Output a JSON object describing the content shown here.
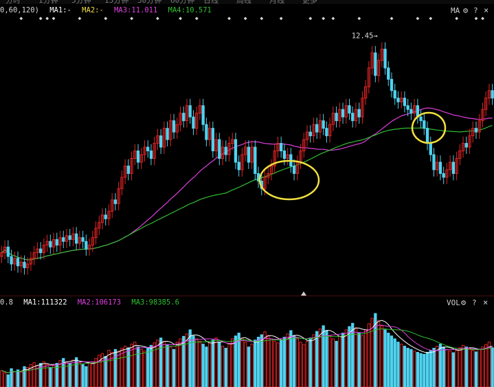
{
  "toolbar": {
    "tabs": [
      "分时",
      "1分钟",
      "5分钟",
      "15分钟",
      "30分钟",
      "60分钟",
      "日线",
      "周线",
      "月线",
      "更多"
    ]
  },
  "price_legend": {
    "period_text": "0,60,120)",
    "ma1": "MA1:-",
    "ma2": "MA2:-",
    "ma3": "MA3:11.011",
    "ma4": "MA4:10.571",
    "ma_button": "MA",
    "settings_icon": "gear-icon",
    "help_text": "?",
    "close_text": "×"
  },
  "volume_legend": {
    "prefix_text": "0.8",
    "ma1": "MA1:111322",
    "ma2": "MA2:106173",
    "ma3": "MA3:98385.6",
    "vol_button": "VOL",
    "settings_icon": "gear-icon",
    "help_text": "?",
    "close_text": "×"
  },
  "colors": {
    "up": "#e02424",
    "down": "#4fd3f0",
    "ma1": "#ffffff",
    "ma2": "#f0e040",
    "ma3": "#e040e0",
    "ma4": "#30c030",
    "annotation": "#f0e040",
    "marker": "#d8d8d8"
  },
  "chart_data": [
    {
      "type": "candlestick",
      "max_price_label": "12.45",
      "closes": [
        6.9,
        7.05,
        6.8,
        6.6,
        6.75,
        6.55,
        6.65,
        6.5,
        6.6,
        6.75,
        6.9,
        7.0,
        6.9,
        7.1,
        7.2,
        7.05,
        7.25,
        7.1,
        7.3,
        7.2,
        7.35,
        7.25,
        7.4,
        7.15,
        7.3,
        7.2,
        7.0,
        7.1,
        7.3,
        7.55,
        7.7,
        7.9,
        7.8,
        8.0,
        8.3,
        8.2,
        8.6,
        8.9,
        9.2,
        9.0,
        9.4,
        9.6,
        9.3,
        9.5,
        9.7,
        9.6,
        9.4,
        9.8,
        10.0,
        9.7,
        10.2,
        9.9,
        10.4,
        10.1,
        10.3,
        10.6,
        10.4,
        10.8,
        10.5,
        10.2,
        10.6,
        10.8,
        10.3,
        9.9,
        10.2,
        9.6,
        9.9,
        9.4,
        9.7,
        9.5,
        9.8,
        9.9,
        9.3,
        9.1,
        9.5,
        9.7,
        9.3,
        9.7,
        9.0,
        8.8,
        8.6,
        8.9,
        9.0,
        9.2,
        9.6,
        9.8,
        9.6,
        9.4,
        9.5,
        9.2,
        9.0,
        9.3,
        9.6,
        9.9,
        10.1,
        10.0,
        10.3,
        10.1,
        10.4,
        10.2,
        10.0,
        10.3,
        10.6,
        10.4,
        10.7,
        10.5,
        10.8,
        10.6,
        10.4,
        10.7,
        10.5,
        11.0,
        11.3,
        11.8,
        12.2,
        11.6,
        12.0,
        12.3,
        11.8,
        11.5,
        11.2,
        11.0,
        10.9,
        11.0,
        10.8,
        10.7,
        10.6,
        10.8,
        10.5,
        10.4,
        10.2,
        9.8,
        9.5,
        9.1,
        9.3,
        9.0,
        8.9,
        9.1,
        9.3,
        9.0,
        9.4,
        9.6,
        9.8,
        9.7,
        10.0,
        10.2,
        10.1,
        10.4,
        10.7,
        11.0,
        11.2,
        11.0
      ],
      "opens": [
        6.8,
        6.9,
        7.05,
        6.8,
        6.6,
        6.75,
        6.55,
        6.65,
        6.5,
        6.6,
        6.75,
        6.9,
        7.0,
        6.9,
        7.1,
        7.2,
        7.05,
        7.25,
        7.1,
        7.3,
        7.2,
        7.35,
        7.25,
        7.4,
        7.15,
        7.3,
        7.2,
        7.0,
        7.1,
        7.3,
        7.55,
        7.7,
        7.9,
        7.8,
        8.0,
        8.3,
        8.2,
        8.6,
        8.9,
        9.2,
        9.0,
        9.4,
        9.6,
        9.3,
        9.5,
        9.7,
        9.6,
        9.4,
        9.8,
        10.0,
        9.7,
        10.2,
        9.9,
        10.4,
        10.1,
        10.3,
        10.6,
        10.4,
        10.8,
        10.5,
        10.2,
        10.6,
        10.8,
        10.3,
        9.9,
        10.2,
        9.6,
        9.9,
        9.4,
        9.7,
        9.5,
        9.8,
        9.9,
        9.3,
        9.1,
        9.5,
        9.7,
        9.3,
        9.7,
        9.0,
        8.8,
        8.6,
        8.9,
        9.0,
        9.2,
        9.6,
        9.8,
        9.6,
        9.4,
        9.5,
        9.2,
        9.0,
        9.3,
        9.6,
        9.9,
        10.1,
        10.0,
        10.3,
        10.1,
        10.4,
        10.2,
        10.0,
        10.3,
        10.6,
        10.4,
        10.7,
        10.5,
        10.8,
        10.6,
        10.4,
        10.7,
        10.5,
        11.0,
        11.3,
        11.8,
        12.2,
        11.6,
        12.0,
        12.3,
        11.8,
        11.5,
        11.2,
        11.0,
        10.9,
        11.0,
        10.8,
        10.7,
        10.6,
        10.8,
        10.5,
        10.4,
        10.2,
        9.8,
        9.5,
        9.1,
        9.3,
        9.0,
        8.9,
        9.1,
        9.3,
        9.0,
        9.4,
        9.6,
        9.8,
        9.7,
        10.0,
        10.2,
        10.1,
        10.4,
        10.7,
        11.0,
        11.2
      ],
      "ma3_start_end": [
        7.3,
        10.8
      ],
      "ma4_start_end": [
        7.6,
        10.1
      ],
      "ylim": [
        6.2,
        12.8
      ],
      "annotations": [
        "ellipse-around-first-pullback",
        "ellipse-around-second-pullback"
      ]
    },
    {
      "type": "bar",
      "series_name": "VOL",
      "values": [
        40,
        35,
        30,
        45,
        38,
        42,
        36,
        50,
        48,
        55,
        60,
        52,
        58,
        62,
        55,
        48,
        52,
        58,
        65,
        70,
        62,
        58,
        66,
        72,
        60,
        55,
        50,
        58,
        62,
        70,
        78,
        82,
        75,
        90,
        85,
        92,
        88,
        95,
        100,
        96,
        105,
        110,
        98,
        92,
        88,
        95,
        102,
        108,
        115,
        120,
        112,
        104,
        98,
        92,
        110,
        118,
        124,
        130,
        140,
        125,
        118,
        112,
        105,
        98,
        108,
        115,
        120,
        110,
        100,
        95,
        105,
        118,
        125,
        132,
        120,
        110,
        98,
        105,
        115,
        122,
        128,
        135,
        126,
        118,
        112,
        108,
        115,
        122,
        130,
        138,
        126,
        118,
        110,
        104,
        112,
        120,
        128,
        136,
        142,
        150,
        138,
        126,
        118,
        112,
        124,
        132,
        140,
        148,
        156,
        145,
        132,
        126,
        140,
        155,
        168,
        180,
        162,
        150,
        140,
        132,
        125,
        118,
        110,
        105,
        100,
        95,
        92,
        88,
        85,
        82,
        80,
        85,
        90,
        95,
        100,
        105,
        98,
        92,
        88,
        84,
        90,
        96,
        102,
        98,
        94,
        90,
        86,
        92,
        98,
        104,
        110,
        96
      ],
      "ylim": [
        0,
        180
      ]
    }
  ]
}
